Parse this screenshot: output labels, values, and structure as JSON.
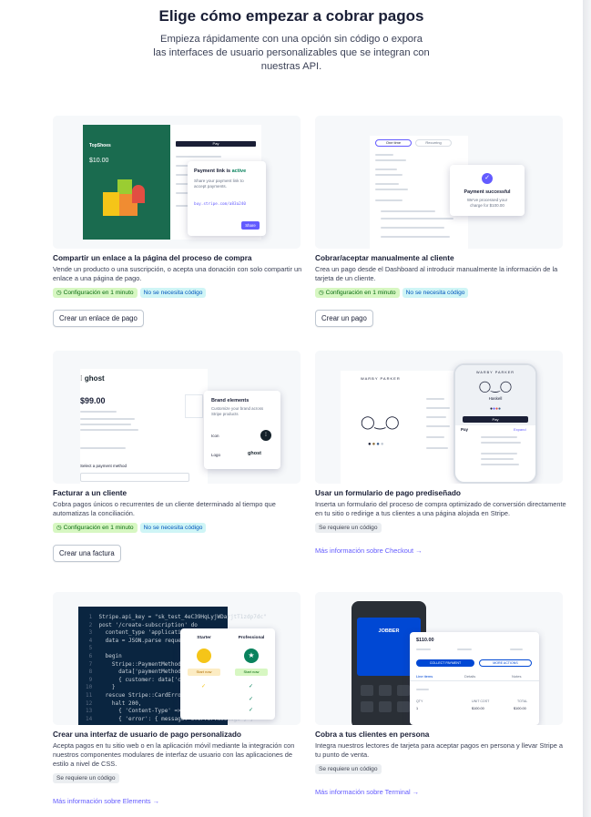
{
  "header": {
    "title": "Elige cómo empezar a cobrar pagos",
    "subtitle": "Empieza rápidamente con una opción sin código o expora las interfaces de usuario personalizables que se integran con nuestras API."
  },
  "cards": [
    {
      "title": "Compartir un enlace a la página del proceso de compra",
      "description": "Vende un producto o una suscripción, o acepta una donación con solo compartir un enlace a una página de pago.",
      "badge1": "Configuración en 1 minuto",
      "badge2": "No se necesita código",
      "button": "Crear un enlace de pago",
      "mock": {
        "brand": "TopShoes",
        "price": "$10.00",
        "pay": "Pay",
        "panel_title_a": "Payment link is ",
        "panel_title_b": "active",
        "panel_text": "Share your payment link to accept payments.",
        "panel_url": "buy.stripe.com/a83a240",
        "panel_button": "Share"
      }
    },
    {
      "title": "Cobrar/aceptar manualmente al cliente",
      "description": "Crea un pago desde el Dashboard al introducir manualmente la información de la tarjeta de un cliente.",
      "badge1": "Configuración en 1 minuto",
      "badge2": "No se necesita código",
      "button": "Crear un pago",
      "mock": {
        "tab1": "One time",
        "tab2": "Recurring",
        "success_title": "Payment successful",
        "success_text": "We've processed your charge for $100.00"
      }
    },
    {
      "title": "Facturar a un cliente",
      "description": "Cobra pagos únicos o recurrentes de un cliente determinado al tiempo que automatizas la conciliación.",
      "badge1": "Configuración en 1 minuto",
      "badge2": "No se necesita código",
      "button": "Crear una factura",
      "mock": {
        "logo": "ghost",
        "amount": "$99.00",
        "panel_title": "Brand elements",
        "panel_text": "Customize your brand across Stripe products",
        "icon_label": "Icon",
        "logo_label": "Logo",
        "select_label": "Select a payment method"
      }
    },
    {
      "title": "Usar un formulario de pago prediseñado",
      "description": "Inserta un formulario del proceso de compra optimizado de conversión directamente en tu sitio o redirige a tus clientes a una página alojada en Stripe.",
      "badge1": "Se requiere un código",
      "link": "Más información sobre Checkout →",
      "mock": {
        "brand": "WARBY PARKER",
        "product": "Haskell",
        "pay": "Pay",
        "expand": "Expand"
      }
    },
    {
      "title": "Crear una interfaz de usuario de pago personalizado",
      "description": "Acepta pagos en tu sitio web o en la aplicación móvil mediante la integración con nuestros componentes modulares de interfaz de usuario con las aplicaciones de estilo a nivel de CSS.",
      "badge1": "Se requiere un código",
      "link": "Más información sobre Elements →",
      "mock": {
        "code": [
          "Stripe.api_key = \"sk_test_4eC39HqLyjWDarjtT1zdp7dc\"",
          "post '/create-subscription' do",
          "  content_type 'application/json'",
          "  data = JSON.parse request.body.read",
          "",
          "  begin",
          "    Stripe::PaymentMethod.attach(",
          "      data['paymentMethodId'],",
          "      { customer: data['customerId'] })",
          "    }",
          "  rescue Stripe::CardError => e",
          "    halt 200,",
          "      { 'Content-Type' => 'application/json' },",
          "      { 'error': { message: e.error.message } }"
        ],
        "plan1": "Starter",
        "plan2": "Professional",
        "start": "Start now"
      }
    },
    {
      "title": "Cobra a tus clientes en persona",
      "description": "Integra nuestros lectores de tarjeta para aceptar pagos en persona y llevar Stripe a tu punto de venta.",
      "badge1": "Se requiere un código",
      "link": "Más información sobre Terminal →",
      "mock": {
        "brand": "JOBBER",
        "amount": "$110.00",
        "collect": "COLLECT PAYMENT",
        "more": "MORE ACTIONS",
        "tab1": "Line items",
        "tab2": "Details",
        "tab3": "Notes",
        "qty": "QTY",
        "unit": "UNIT COST",
        "total": "TOTAL",
        "qty_val": "1",
        "unit_val": "$100.00",
        "total_val": "$100.00"
      }
    }
  ]
}
